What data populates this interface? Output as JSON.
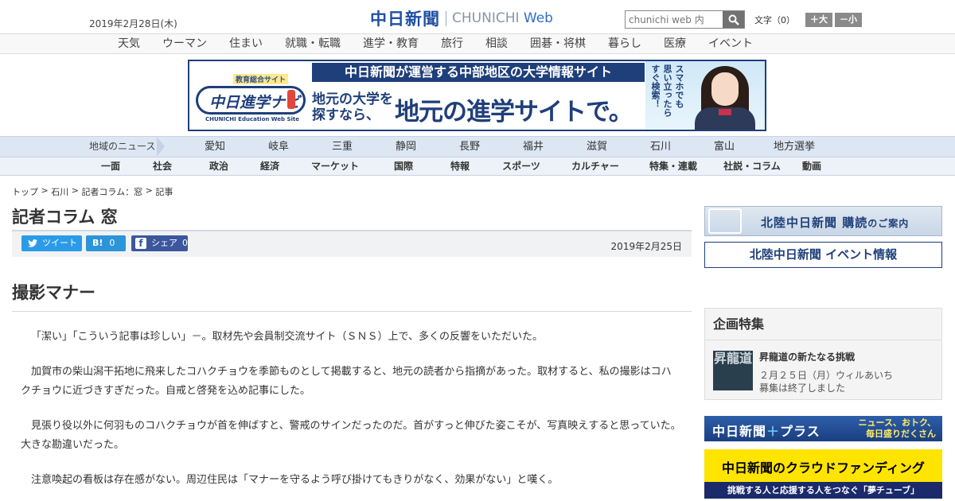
{
  "header": {
    "date": "2019年2月28日(木)",
    "logo_jp": "中日新聞",
    "logo_en_a": "CHUNICHI",
    "logo_en_b": "Web",
    "search_placeholder": "chunichi web 内",
    "fontsize_label": "文字（0）",
    "fontsize_up": "＋大",
    "fontsize_down": "－小"
  },
  "category_nav": [
    "天気",
    "ウーマン",
    "住まい",
    "就職・転職",
    "進学・教育",
    "旅行",
    "相談",
    "囲碁・将棋",
    "暮らし",
    "医療",
    "イベント"
  ],
  "banner": {
    "logo_caption": "教育総合サイト",
    "logo_name": "中日進学ナビ",
    "logo_sub": "CHUNICHI Education Web Site",
    "headline": "中日新聞が運営する中部地区の大学情報サイト",
    "small": [
      "地元の大学を",
      "探すなら、"
    ],
    "big": "地元の進学サイトで。",
    "vertical": [
      "スマホでも",
      "思い立ったら",
      "すぐ検索！"
    ]
  },
  "region_nav": {
    "label": "地域のニュース",
    "items": [
      "愛知",
      "岐阜",
      "三重",
      "静岡",
      "長野",
      "福井",
      "滋賀",
      "石川",
      "富山",
      "地方選挙"
    ]
  },
  "section_nav": [
    "一面",
    "社会",
    "政治",
    "経済",
    "マーケット",
    "国際",
    "特報",
    "スポーツ",
    "カルチャー",
    "特集・連載",
    "社説・コラム",
    "動画"
  ],
  "breadcrumb": [
    "トップ",
    "石川",
    "記者コラム：窓",
    "記事"
  ],
  "column_title": "記者コラム 窓",
  "share": {
    "tweet": "ツイート",
    "hatena_label": "B!",
    "hatena_count": "0",
    "fb_label": "シェア",
    "fb_count": "0"
  },
  "pub_date": "2019年2月25日",
  "article": {
    "title": "撮影マナー",
    "paragraphs": [
      "「潔い」「こういう記事は珍しい」－。取材先や会員制交流サイト（ＳＮＳ）上で、多くの反響をいただいた。",
      "加賀市の柴山潟干拓地に飛来したコハクチョウを季節ものとして掲載すると、地元の読者から指摘があった。取材すると、私の撮影はコハクチョウに近づきすぎだった。自戒と啓発を込め記事にした。",
      "見張り役以外に何羽ものコハクチョウが首を伸ばすと、警戒のサインだったのだ。首がすっと伸びた姿こそが、写真映えすると思っていた。大きな勘違いだった。",
      "注意喚起の看板は存在感がない。周辺住民は「マナーを守るよう呼び掛けてもきりがなく、効果がない」と嘆く。"
    ]
  },
  "sidebar": {
    "subscribe_a": "北陸中日新聞 購読",
    "subscribe_b": "のご案内",
    "event": "北陸中日新聞 イベント情報",
    "special_heading": "企画特集",
    "special_img_text": "昇龍道",
    "special_title": "昇龍道の新たなる挑戦",
    "special_date": "２月２５日（月）ウィルあいち",
    "special_note": "募集は終了しました",
    "plus_a1": "中日新聞",
    "plus_a2": "＋",
    "plus_a3": "プラス",
    "plus_b1": "ニュース、おトク、",
    "plus_b2": "毎日盛りだくさん",
    "cf_a": "中日新聞のクラウドファンディング",
    "cf_b": "挑戦する人と応援する人をつなぐ「夢チューブ」"
  }
}
